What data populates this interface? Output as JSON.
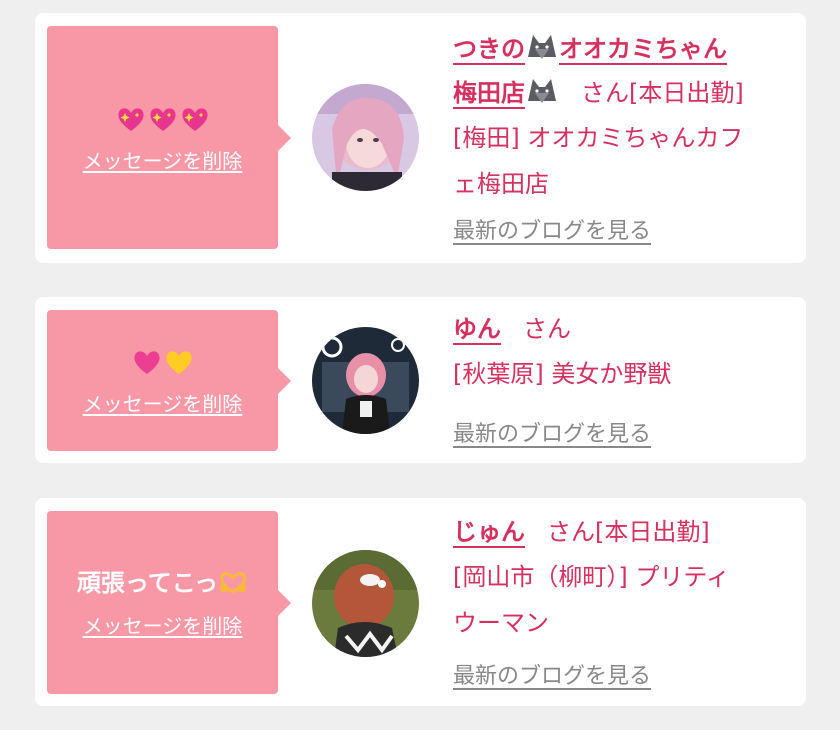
{
  "colors": {
    "background": "#efefef",
    "card": "#ffffff",
    "bubble": "#f898a6",
    "accent": "#d6305f",
    "muted": "#888888"
  },
  "messages": [
    {
      "message_text": "",
      "message_icons": [
        "sparkling-heart-icon",
        "sparkling-heart-icon",
        "sparkling-heart-icon"
      ],
      "delete_label": "メッセージを削除",
      "avatar": "avatar-photo-1",
      "name_part1": "つきの",
      "name_part2": "オオカミちゃん",
      "name_part3": "梅田店",
      "name_icon": "wolf-icon",
      "honorific": "さん",
      "status": "[本日出勤]",
      "shop_line1": "[梅田] オオカミちゃんカフ",
      "shop_line2": "ェ梅田店",
      "blog_label": "最新のブログを見る"
    },
    {
      "message_text": "",
      "message_icons": [
        "pink-heart-icon",
        "yellow-heart-icon"
      ],
      "delete_label": "メッセージを削除",
      "avatar": "avatar-photo-2",
      "name": "ゆん",
      "honorific": "さん",
      "status": "",
      "shop_line1": "[秋葉原] 美女か野獣",
      "blog_label": "最新のブログを見る"
    },
    {
      "message_text": "頑張ってこっ",
      "message_icons": [
        "heart-hands-icon"
      ],
      "delete_label": "メッセージを削除",
      "avatar": "avatar-photo-3",
      "name": "じゅん",
      "honorific": "さん",
      "status": "[本日出勤]",
      "shop_line1": "[岡山市（柳町）] プリティ",
      "shop_line2": "ウーマン",
      "blog_label": "最新のブログを見る"
    }
  ]
}
